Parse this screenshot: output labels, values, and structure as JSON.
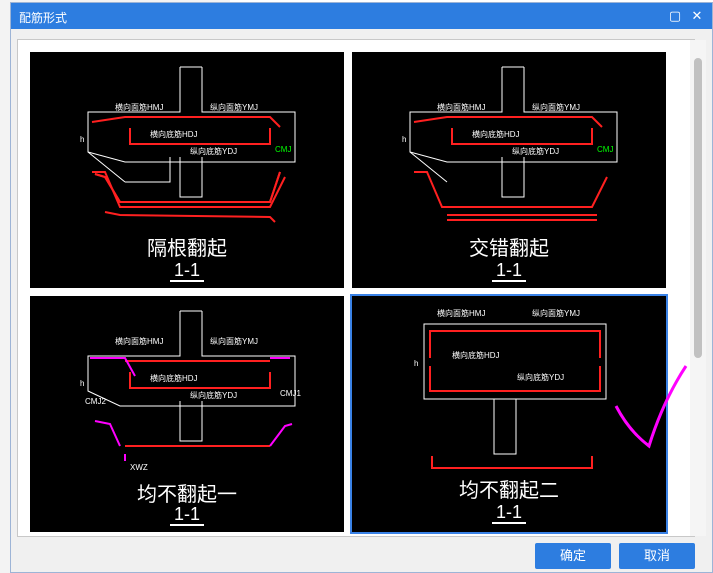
{
  "window": {
    "title": "配筋形式"
  },
  "options": [
    {
      "name": "隔根翻起",
      "section": "1-1"
    },
    {
      "name": "交错翻起",
      "section": "1-1"
    },
    {
      "name": "均不翻起一",
      "section": "1-1"
    },
    {
      "name": "均不翻起二",
      "section": "1-1"
    }
  ],
  "labels": {
    "hmj": "横向面筋HMJ",
    "ymj": "纵向面筋YMJ",
    "hdj": "横向底筋HDJ",
    "ydj": "纵向底筋YDJ",
    "cmj": "CMJ",
    "cmj1": "CMJ1",
    "cmj2": "CMJ2",
    "xwz": "XWZ",
    "h": "h"
  },
  "buttons": {
    "ok": "确定",
    "cancel": "取消"
  },
  "selected_index": 3
}
